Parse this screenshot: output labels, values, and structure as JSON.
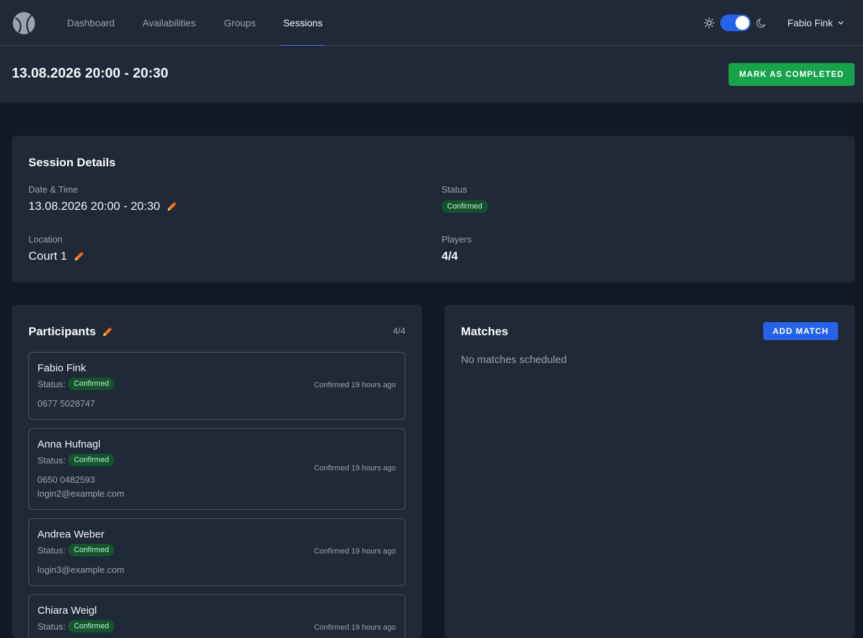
{
  "nav": {
    "items": [
      {
        "label": "Dashboard",
        "active": false
      },
      {
        "label": "Availabilities",
        "active": false
      },
      {
        "label": "Groups",
        "active": false
      },
      {
        "label": "Sessions",
        "active": true
      }
    ],
    "theme_toggle": {
      "dark_mode": true,
      "icons": [
        "sun-icon",
        "moon-icon"
      ]
    },
    "user": {
      "name": "Fabio Fink"
    }
  },
  "header": {
    "title": "13.08.2026 20:00 - 20:30",
    "complete_button": "MARK AS COMPLETED"
  },
  "session_details": {
    "title": "Session Details",
    "date_time_label": "Date & Time",
    "date_time": "13.08.2026 20:00 - 20:30",
    "status_label": "Status",
    "status": "Confirmed",
    "location_label": "Location",
    "location": "Court 1",
    "players_label": "Players",
    "players": "4/4"
  },
  "participants": {
    "title": "Participants",
    "count": "4/4",
    "status_label": "Status:",
    "list": [
      {
        "name": "Fabio Fink",
        "status": "Confirmed",
        "time": "Confirmed 19 hours ago",
        "phone": "0677 5028747",
        "email": ""
      },
      {
        "name": "Anna Hufnagl",
        "status": "Confirmed",
        "time": "Confirmed 19 hours ago",
        "phone": "0650 0482593",
        "email": "login2@example.com"
      },
      {
        "name": "Andrea Weber",
        "status": "Confirmed",
        "time": "Confirmed 19 hours ago",
        "phone": "",
        "email": "login3@example.com"
      },
      {
        "name": "Chiara Weigl",
        "status": "Confirmed",
        "time": "Confirmed 19 hours ago",
        "phone": "",
        "email": ""
      }
    ]
  },
  "matches": {
    "title": "Matches",
    "add_button": "ADD MATCH",
    "empty_text": "No matches scheduled"
  },
  "colors": {
    "page_bg": "#111827",
    "card_bg": "#1f2937",
    "success": "#16a34a",
    "primary": "#2563eb",
    "accent_underline": "#6366f1",
    "edit_icon": "#f97316"
  }
}
